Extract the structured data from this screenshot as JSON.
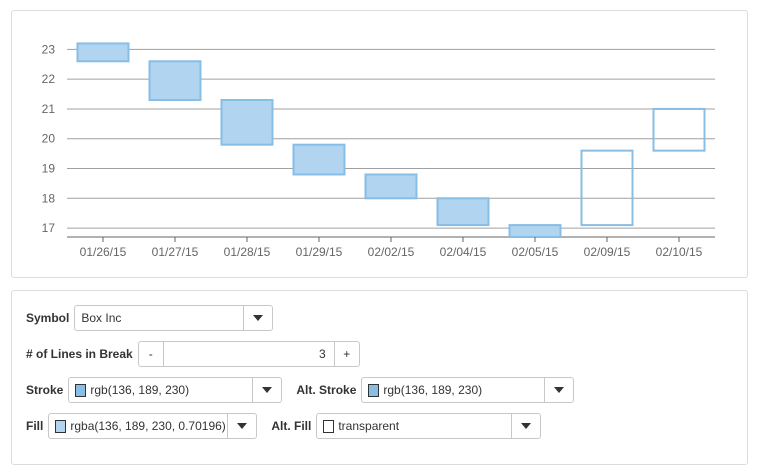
{
  "chart_data": {
    "type": "line-break",
    "categories": [
      "01/26/15",
      "01/27/15",
      "01/28/15",
      "01/29/15",
      "02/02/15",
      "02/04/15",
      "02/05/15",
      "02/09/15",
      "02/10/15"
    ],
    "boxes": [
      {
        "open": 23.2,
        "close": 22.6,
        "direction": "down"
      },
      {
        "open": 22.6,
        "close": 21.3,
        "direction": "down"
      },
      {
        "open": 21.3,
        "close": 19.8,
        "direction": "down"
      },
      {
        "open": 19.8,
        "close": 18.8,
        "direction": "down"
      },
      {
        "open": 18.8,
        "close": 18.0,
        "direction": "down"
      },
      {
        "open": 18.0,
        "close": 17.1,
        "direction": "down"
      },
      {
        "open": 17.1,
        "close": 16.6,
        "direction": "down"
      },
      {
        "open": 17.1,
        "close": 19.6,
        "direction": "up"
      },
      {
        "open": 19.6,
        "close": 21.0,
        "direction": "up"
      }
    ],
    "yticks": [
      "17",
      "18",
      "19",
      "20",
      "21",
      "22",
      "23"
    ],
    "ylim": [
      16.7,
      23.55
    ],
    "grid": true,
    "colors": {
      "stroke": "#88bde6",
      "fill": "#b1d5f0",
      "alt_stroke": "#88bde6",
      "alt_fill": "transparent",
      "grid": "#a0a0a0",
      "axis": "#666666"
    }
  },
  "controls": {
    "symbol": {
      "label": "Symbol",
      "value": "Box Inc"
    },
    "lines_in_break": {
      "label": "# of Lines in Break",
      "minus": "-",
      "value": "3",
      "plus": "+"
    },
    "stroke": {
      "label": "Stroke",
      "value": "rgb(136, 189, 230)",
      "swatch": "#88bde6"
    },
    "alt_stroke": {
      "label": "Alt. Stroke",
      "value": "rgb(136, 189, 230)",
      "swatch": "#88bde6"
    },
    "fill": {
      "label": "Fill",
      "value": "rgba(136, 189, 230, 0.70196)",
      "swatch": "#b1d5f0"
    },
    "alt_fill": {
      "label": "Alt. Fill",
      "value": "transparent",
      "swatch": "transparent"
    }
  }
}
